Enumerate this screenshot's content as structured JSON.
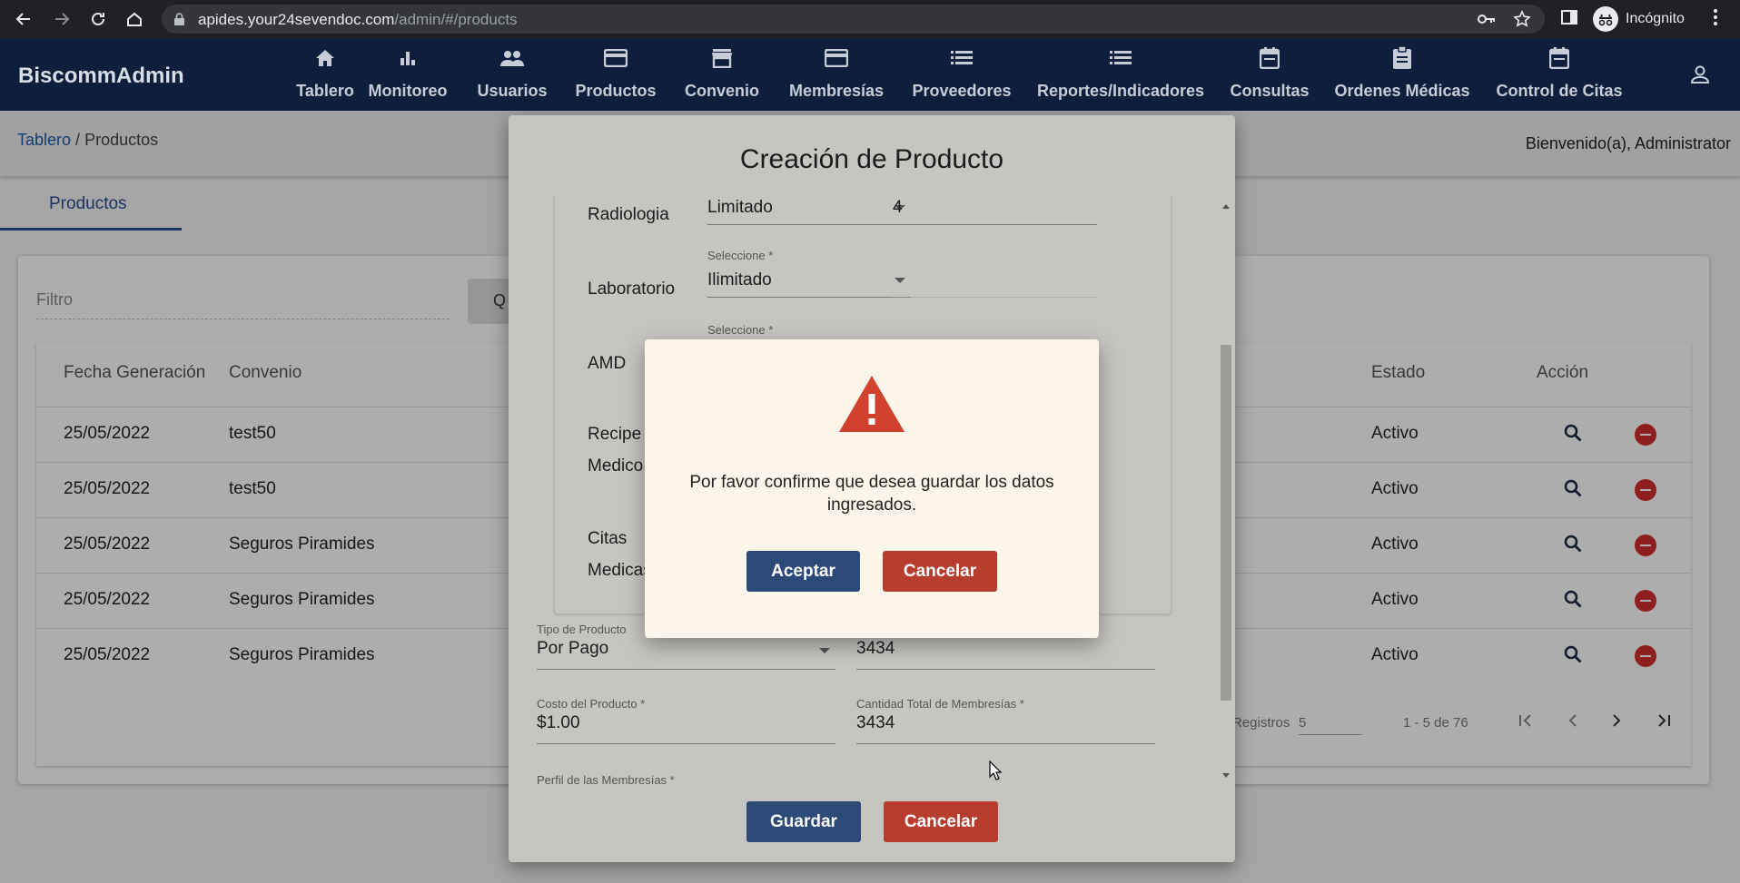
{
  "browser": {
    "url_host": "apides.your24sevendoc.com",
    "url_path": "/admin/#/products",
    "incognito_label": "Incógnito"
  },
  "app": {
    "brand": "BiscommAdmin",
    "nav": [
      {
        "label": "Tablero",
        "icon": "home-icon"
      },
      {
        "label": "Monitoreo",
        "icon": "bar-chart-icon"
      },
      {
        "label": "Usuarios",
        "icon": "people-icon"
      },
      {
        "label": "Productos",
        "icon": "card-icon"
      },
      {
        "label": "Convenio",
        "icon": "store-icon"
      },
      {
        "label": "Membresías",
        "icon": "card-icon"
      },
      {
        "label": "Proveedores",
        "icon": "list-icon"
      },
      {
        "label": "Reportes/Indicadores",
        "icon": "list-icon"
      },
      {
        "label": "Consultas",
        "icon": "calendar-icon"
      },
      {
        "label": "Ordenes Médicas",
        "icon": "clipboard-icon"
      },
      {
        "label": "Control de Citas",
        "icon": "calendar-icon"
      }
    ]
  },
  "breadcrumb": {
    "home": "Tablero",
    "sep": " / ",
    "current": "Productos"
  },
  "welcome": "Bienvenido(a), Administrator",
  "tab": "Productos",
  "filter": {
    "placeholder": "Filtro",
    "button": "Q"
  },
  "table": {
    "headers": {
      "fecha": "Fecha Generación",
      "convenio": "Convenio",
      "estado": "Estado",
      "accion": "Acción"
    },
    "rows": [
      {
        "fecha": "25/05/2022",
        "convenio": "test50",
        "estado": "Activo"
      },
      {
        "fecha": "25/05/2022",
        "convenio": "test50",
        "estado": "Activo"
      },
      {
        "fecha": "25/05/2022",
        "convenio": "Seguros Piramides",
        "estado": "Activo"
      },
      {
        "fecha": "25/05/2022",
        "convenio": "Seguros Piramides",
        "estado": "Activo"
      },
      {
        "fecha": "25/05/2022",
        "convenio": "Seguros Piramides",
        "estado": "Activo"
      }
    ],
    "pager": {
      "registros_label": "Registros",
      "registros_value": "5",
      "range": "1 - 5 de 76"
    }
  },
  "modal": {
    "title": "Creación de Producto",
    "services": [
      {
        "label": "Radiologia",
        "select_label": "",
        "select_value": "Limitado",
        "qty": "4"
      },
      {
        "label": "Laboratorio",
        "select_label": "Seleccione *",
        "select_value": "Ilimitado",
        "qty": ""
      },
      {
        "label": "AMD",
        "select_label": "Seleccione *",
        "select_value": "",
        "qty": ""
      },
      {
        "label_line1": "Recipe",
        "label_line2": "Medico"
      },
      {
        "label_line1": "Citas",
        "label_line2": "Medicas"
      }
    ],
    "tipo_producto_label": "Tipo de Producto",
    "tipo_producto_value": "Por Pago",
    "tipo_right_value": "3434",
    "costo_label": "Costo del Producto *",
    "costo_value": "$1.00",
    "cantidad_label": "Cantidad Total de Membresías *",
    "cantidad_value": "3434",
    "perfil_label": "Perfil de las Membresías *",
    "save_button": "Guardar",
    "cancel_button": "Cancelar"
  },
  "dialog": {
    "message": "Por favor confirme que desea guardar los datos ingresados.",
    "accept_button": "Aceptar",
    "cancel_button": "Cancelar",
    "icon": "warning-icon",
    "icon_color": "#d0412e"
  }
}
